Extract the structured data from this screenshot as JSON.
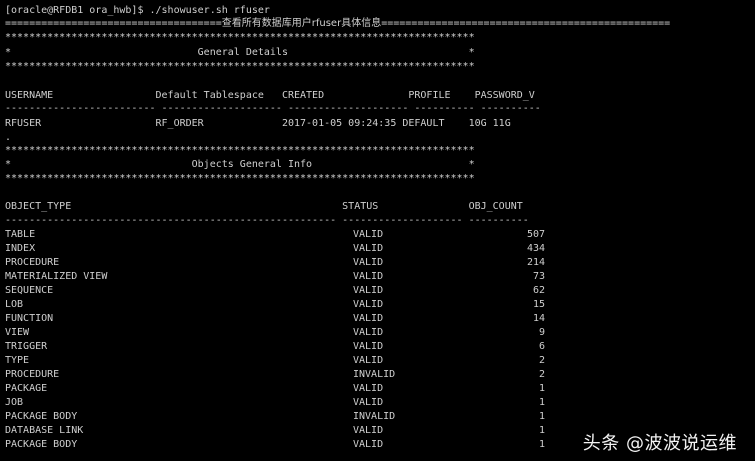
{
  "top_partial": "--------------------------",
  "prompt": "[oracle@RFDB1 ora_hwb]$ ./showuser.sh rfuser",
  "banner_left": "====================================",
  "banner_cn": "查看所有数据库用户rfuser具体信息",
  "banner_right": "================================================",
  "stars": "******************************************************************************",
  "general_title": "*                               General Details                              *",
  "user_header": "USERNAME                 Default Tablespace   CREATED              PROFILE    PASSWORD_V",
  "user_sep": "------------------------- -------------------- -------------------- ---------- ----------",
  "user_row": "RFUSER                   RF_ORDER             2017-01-05 09:24:35 DEFAULT    10G 11G",
  "dot": ".",
  "objects_title": "*                              Objects General Info                          *",
  "obj_header": "OBJECT_TYPE                                             STATUS               OBJ_COUNT",
  "obj_sep": "------------------------------------------------------- -------------------- ----------",
  "objects": [
    {
      "type": "TABLE",
      "status": "VALID",
      "count": "507"
    },
    {
      "type": "INDEX",
      "status": "VALID",
      "count": "434"
    },
    {
      "type": "PROCEDURE",
      "status": "VALID",
      "count": "214"
    },
    {
      "type": "MATERIALIZED VIEW",
      "status": "VALID",
      "count": "73"
    },
    {
      "type": "SEQUENCE",
      "status": "VALID",
      "count": "62"
    },
    {
      "type": "LOB",
      "status": "VALID",
      "count": "15"
    },
    {
      "type": "FUNCTION",
      "status": "VALID",
      "count": "14"
    },
    {
      "type": "VIEW",
      "status": "VALID",
      "count": "9"
    },
    {
      "type": "TRIGGER",
      "status": "VALID",
      "count": "6"
    },
    {
      "type": "TYPE",
      "status": "VALID",
      "count": "2"
    },
    {
      "type": "PROCEDURE",
      "status": "INVALID",
      "count": "2"
    },
    {
      "type": "PACKAGE",
      "status": "VALID",
      "count": "1"
    },
    {
      "type": "JOB",
      "status": "VALID",
      "count": "1"
    },
    {
      "type": "PACKAGE BODY",
      "status": "INVALID",
      "count": "1"
    },
    {
      "type": "DATABASE LINK",
      "status": "VALID",
      "count": "1"
    },
    {
      "type": "PACKAGE BODY",
      "status": "VALID",
      "count": "1"
    }
  ],
  "watermark": "头条 @波波说运维"
}
